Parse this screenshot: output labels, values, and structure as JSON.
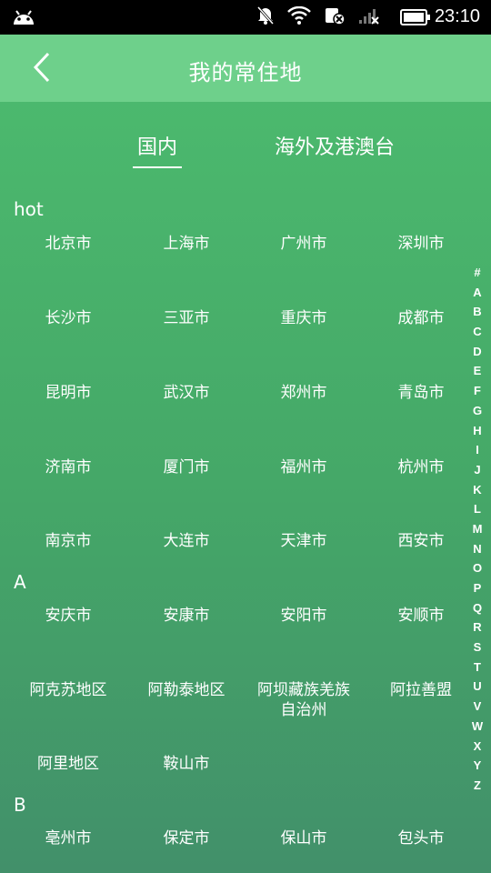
{
  "status": {
    "time": "23:10"
  },
  "appbar": {
    "title": "我的常住地"
  },
  "tabs": [
    {
      "label": "国内",
      "active": true
    },
    {
      "label": "海外及港澳台",
      "active": false
    }
  ],
  "sections": [
    {
      "head": "hot",
      "cities": [
        "北京市",
        "上海市",
        "广州市",
        "深圳市",
        "长沙市",
        "三亚市",
        "重庆市",
        "成都市",
        "昆明市",
        "武汉市",
        "郑州市",
        "青岛市",
        "济南市",
        "厦门市",
        "福州市",
        "杭州市",
        "南京市",
        "大连市",
        "天津市",
        "西安市"
      ]
    },
    {
      "head": "A",
      "cities": [
        "安庆市",
        "安康市",
        "安阳市",
        "安顺市",
        "阿克苏地区",
        "阿勒泰地区",
        "阿坝藏族羌族自治州",
        "阿拉善盟",
        "阿里地区",
        "鞍山市"
      ]
    },
    {
      "head": "B",
      "cities": [
        "亳州市",
        "保定市",
        "保山市",
        "包头市"
      ]
    }
  ],
  "index_letters": [
    "#",
    "A",
    "B",
    "C",
    "D",
    "E",
    "F",
    "G",
    "H",
    "I",
    "J",
    "K",
    "L",
    "M",
    "N",
    "O",
    "P",
    "Q",
    "R",
    "S",
    "T",
    "U",
    "V",
    "W",
    "X",
    "Y",
    "Z"
  ],
  "colors": {
    "appbar": "#6ed08b",
    "bg_top": "#4dbd6f",
    "bg_bottom": "#42906a",
    "text": "#ffffff"
  }
}
